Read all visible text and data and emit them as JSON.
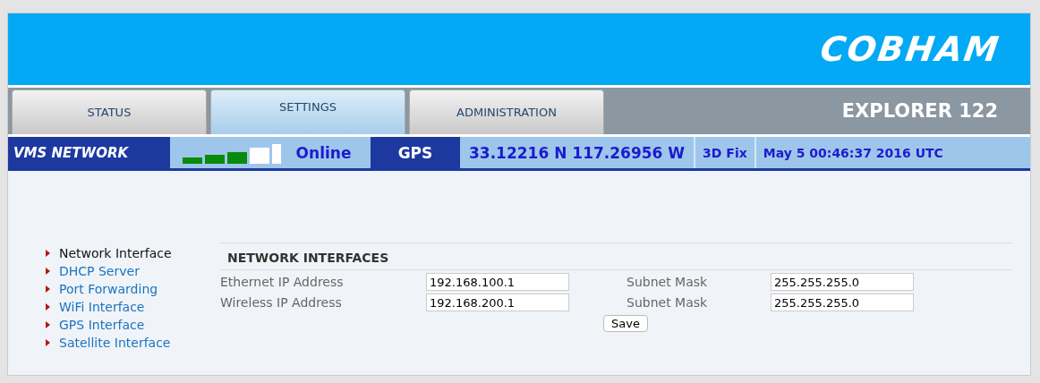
{
  "header": {
    "logo": "COBHAM"
  },
  "tabs": [
    {
      "label": "STATUS",
      "selected": false
    },
    {
      "label": "SETTINGS",
      "selected": true
    },
    {
      "label": "ADMINISTRATION",
      "selected": false
    }
  ],
  "product": "EXPLORER 122",
  "status_bar": {
    "network_label": "VMS NETWORK",
    "network_status": "Online",
    "gps_label": "GPS",
    "position": "33.12216 N 117.26956 W",
    "fix": "3D Fix",
    "time": "May 5 00:46:37 2016 UTC"
  },
  "sidebar": {
    "items": [
      {
        "label": "Network Interface",
        "selected": true
      },
      {
        "label": "DHCP Server",
        "selected": false
      },
      {
        "label": "Port Forwarding",
        "selected": false
      },
      {
        "label": "WiFi Interface",
        "selected": false
      },
      {
        "label": "GPS Interface",
        "selected": false
      },
      {
        "label": "Satellite Interface",
        "selected": false
      }
    ]
  },
  "section": {
    "title": "NETWORK INTERFACES",
    "rows": [
      {
        "label": "Ethernet IP Address",
        "value": "192.168.100.1",
        "mask_label": "Subnet Mask",
        "mask": "255.255.255.0"
      },
      {
        "label": "Wireless IP Address",
        "value": "192.168.200.1",
        "mask_label": "Subnet Mask",
        "mask": "255.255.255.0"
      }
    ],
    "button": "Save"
  }
}
